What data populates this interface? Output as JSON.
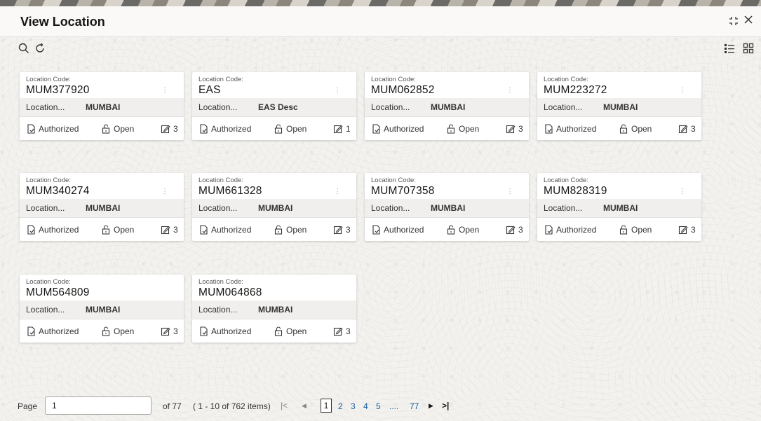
{
  "window": {
    "title": "View Location"
  },
  "toolbar": {
    "search_icon": "search-icon",
    "refresh_icon": "refresh-icon",
    "list_view_icon": "list-view-icon",
    "tile_view_icon": "tile-view-icon"
  },
  "header_icons": {
    "collapse_icon": "collapse-icon",
    "close_icon": "close-icon"
  },
  "card_labels": {
    "code_label": "Location Code:",
    "desc_label": "Location...",
    "status_authorized": "Authorized",
    "status_open": "Open"
  },
  "cards": [
    {
      "code": "MUM377920",
      "desc": "MUMBAI",
      "edits": "3"
    },
    {
      "code": "EAS",
      "desc": "EAS Desc",
      "edits": "1"
    },
    {
      "code": "MUM062852",
      "desc": "MUMBAI",
      "edits": "3"
    },
    {
      "code": "MUM223272",
      "desc": "MUMBAI",
      "edits": "3"
    },
    {
      "code": "MUM340274",
      "desc": "MUMBAI",
      "edits": "3"
    },
    {
      "code": "MUM661328",
      "desc": "MUMBAI",
      "edits": "3"
    },
    {
      "code": "MUM707358",
      "desc": "MUMBAI",
      "edits": "3"
    },
    {
      "code": "MUM828319",
      "desc": "MUMBAI",
      "edits": "3"
    },
    {
      "code": "MUM564809",
      "desc": "MUMBAI",
      "edits": "3"
    },
    {
      "code": "MUM064868",
      "desc": "MUMBAI",
      "edits": "3"
    }
  ],
  "pagination": {
    "page_label": "Page",
    "page_value": "1",
    "of_total": "of 77",
    "range": "( 1 - 10 of 762 items)",
    "current_page": "1",
    "pages": [
      "2",
      "3",
      "4",
      "5"
    ],
    "ellipsis": "....",
    "last_page": "77"
  },
  "colors": {
    "link": "#1a5d9b",
    "card_desc_bg": "#f1efed"
  }
}
